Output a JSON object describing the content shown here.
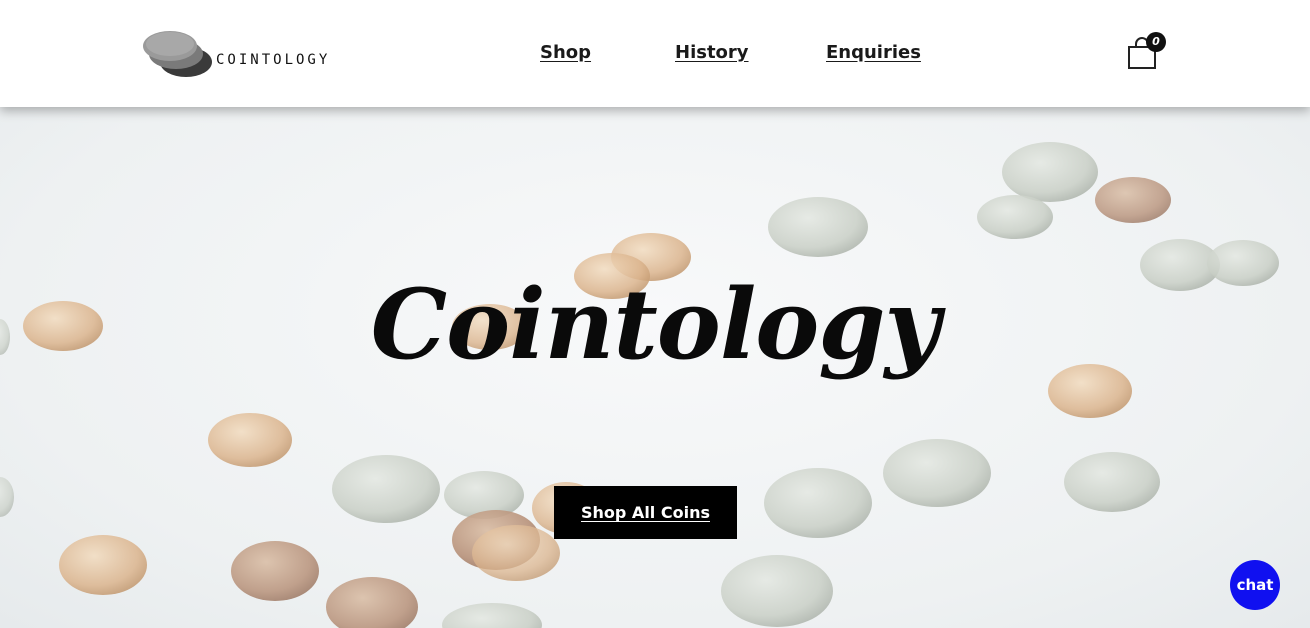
{
  "header": {
    "logo_text": "COINTOLOGY",
    "nav": [
      {
        "label": "Shop"
      },
      {
        "label": "History"
      },
      {
        "label": "Enquiries"
      }
    ],
    "cart": {
      "icon": "shopping-bag-icon",
      "count": "0"
    }
  },
  "hero": {
    "title": "Cointology",
    "cta_label": "Shop All Coins",
    "background": "scattered-coins-photo"
  },
  "chat": {
    "label": "chat",
    "color": "#1010f0"
  }
}
